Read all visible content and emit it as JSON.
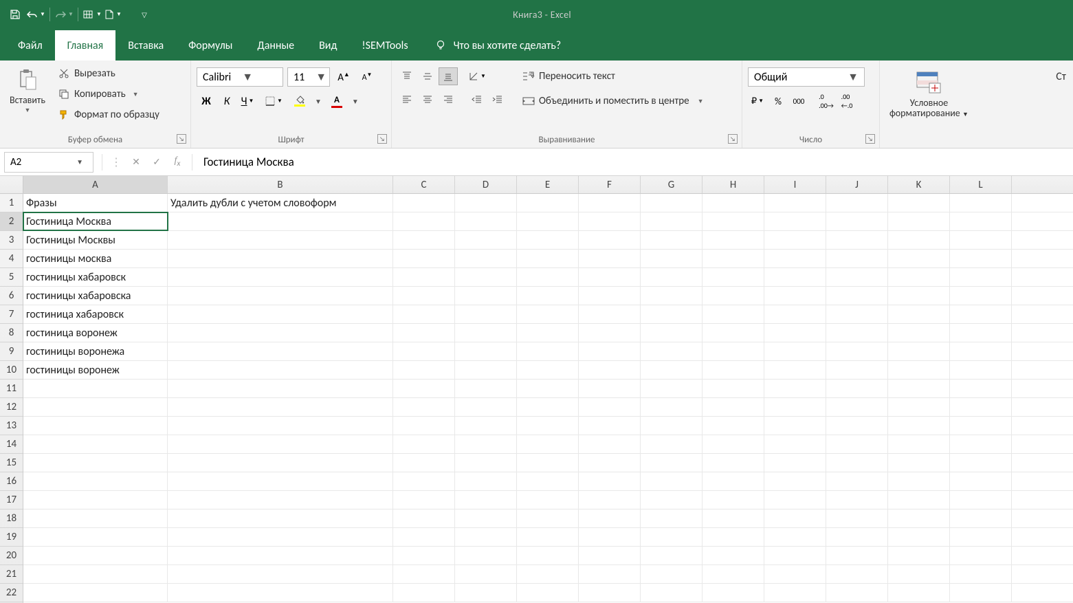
{
  "title": {
    "doc": "Книга3",
    "app": "Excel",
    "sep": "  -  "
  },
  "tabs": {
    "file": "Файл",
    "home": "Главная",
    "insert": "Вставка",
    "formulas": "Формулы",
    "data": "Данные",
    "view": "Вид",
    "semtools": "!SEMTools",
    "tellme": "Что вы хотите сделать?"
  },
  "ribbon": {
    "clipboard": {
      "label": "Буфер обмена",
      "paste": "Вставить",
      "cut": "Вырезать",
      "copy": "Копировать",
      "format_painter": "Формат по образцу"
    },
    "font": {
      "label": "Шрифт",
      "name": "Calibri",
      "size": "11",
      "bold": "Ж",
      "italic": "К",
      "underline": "Ч",
      "font_color_a": "А"
    },
    "alignment": {
      "label": "Выравнивание",
      "wrap": "Переносить текст",
      "merge": "Объединить и поместить в центре"
    },
    "number": {
      "label": "Число",
      "format": "Общий",
      "pct": "%",
      "thou": "000"
    },
    "cond": {
      "label": "Условное форматирование",
      "label_line1": "Условное",
      "label_line2": "форматирование"
    },
    "st_cut": "Ст"
  },
  "formulabar": {
    "name": "A2",
    "value": "Гостиница Москва"
  },
  "grid": {
    "col_widths": {
      "A": 210,
      "B": 328,
      "default": 90
    },
    "columns": [
      "A",
      "B",
      "C",
      "D",
      "E",
      "F",
      "G",
      "H",
      "I",
      "J",
      "K",
      "L"
    ],
    "rows_visible": 22,
    "active_cell": "A2",
    "data": {
      "header_row": {
        "A": "Фразы",
        "B": "Удалить дубли с учетом словоформ"
      },
      "col_a": [
        "Гостиница Москва",
        "Гостиницы Москвы",
        "гостиницы москва",
        "гостиницы хабаровск",
        "гостиницы хабаровска",
        "гостиница хабаровск",
        "гостиница воронеж",
        "гостиницы воронежа",
        "гостиницы воронеж"
      ]
    }
  }
}
